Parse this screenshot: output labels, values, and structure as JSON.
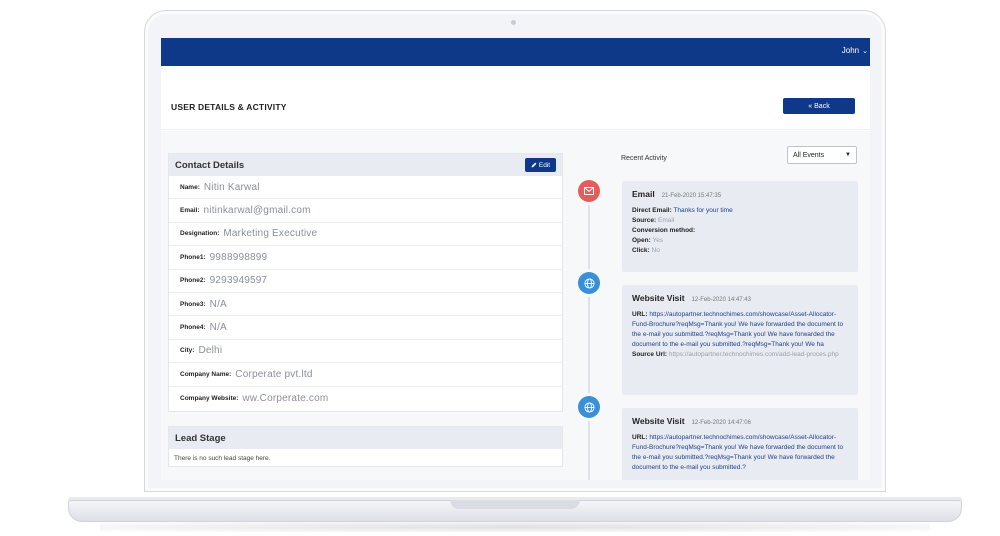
{
  "app": {
    "user_name": "John"
  },
  "header": {
    "title": "USER DETAILS & ACTIVITY",
    "back_label": "« Back"
  },
  "contact": {
    "title": "Contact Details",
    "edit_label": "Edit",
    "fields": [
      {
        "label": "Name:",
        "value": "Nitin Karwal"
      },
      {
        "label": "Email:",
        "value": "nitinkarwal@gmail.com"
      },
      {
        "label": "Designation:",
        "value": "Marketing Executive"
      },
      {
        "label": "Phone1:",
        "value": "9988998899"
      },
      {
        "label": "Phone2:",
        "value": "9293949597"
      },
      {
        "label": "Phone3:",
        "value": "N/A"
      },
      {
        "label": "Phone4:",
        "value": "N/A"
      },
      {
        "label": "City:",
        "value": "Delhi"
      },
      {
        "label": "Company Name:",
        "value": "Corperate pvt.ltd"
      },
      {
        "label": "Company Website:",
        "value": "ww.Corperate.com"
      }
    ]
  },
  "lead": {
    "title": "Lead Stage",
    "empty_text": "There is no such lead stage here."
  },
  "activity": {
    "label": "Recent Activity",
    "filter": "All Events",
    "events": [
      {
        "type": "Email",
        "time": "21-Feb-2020 15:47:35",
        "icon": "envelope-icon",
        "fields": [
          {
            "k": "Direct Email:",
            "v": "Thanks for your time"
          },
          {
            "k": "Source:",
            "v": "Email"
          },
          {
            "k": "Conversion method:",
            "v": ""
          },
          {
            "k": "Open:",
            "v": "Yes"
          },
          {
            "k": "Click:",
            "v": "No"
          }
        ]
      },
      {
        "type": "Website Visit",
        "time": "12-Feb-2020 14:47:43",
        "icon": "globe-icon",
        "url_label": "URL:",
        "url": "https://autopartner.technochimes.com/showcase/Asset-Allocator-Fund-Brochure?reqMsg=Thank you! We have forwarded the document to the e-mail you submitted.?reqMsg=Thank you! We have forwarded the document to the e-mail you submitted.?reqMsg=Thank you! We ha",
        "source_label": "Source Url:",
        "source": "https://autopartner.technochimes.com/add-lead-proces.php"
      },
      {
        "type": "Website Visit",
        "time": "12-Feb-2020 14:47:06",
        "icon": "globe-icon",
        "url_label": "URL:",
        "url": "https://autopartner.technochimes.com/showcase/Asset-Allocator-Fund-Brochure?reqMsg=Thank you! We have forwarded the document to the e-mail you submitted.?reqMsg=Thank you! We have forwarded the document to the e-mail you submitted.?"
      }
    ]
  },
  "colors": {
    "brand": "#0e3989",
    "email_dot": "#e35d5d",
    "web_dot": "#3a8fd6"
  }
}
